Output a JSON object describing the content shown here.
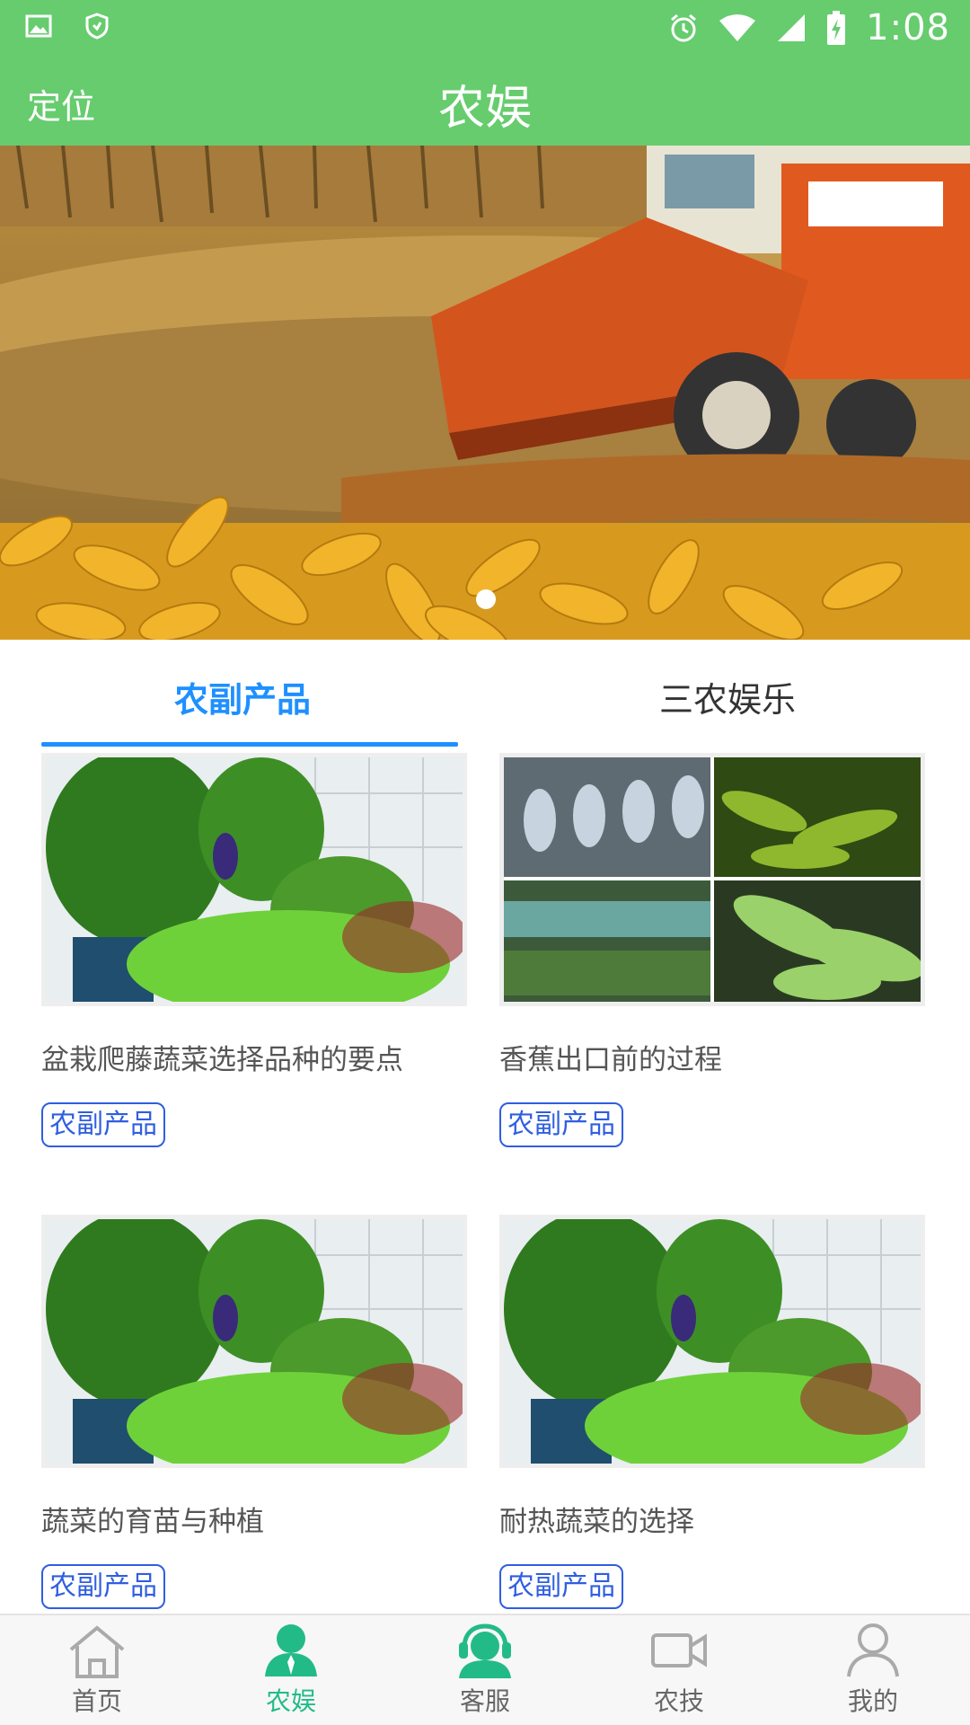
{
  "status_bar": {
    "time": "1:08"
  },
  "app_bar": {
    "left_label": "定位",
    "title": "农娱"
  },
  "banner": {
    "image": "corn-harvester-photo"
  },
  "tabs": [
    {
      "label": "农副产品",
      "active": true
    },
    {
      "label": "三农娱乐",
      "active": false
    }
  ],
  "cards": [
    {
      "title": "盆栽爬藤蔬菜选择品种的要点",
      "tag": "农副产品",
      "image": "vegetable-garden-photo"
    },
    {
      "title": "香蕉出口前的过程",
      "tag": "农副产品",
      "image": "banana-collage-photo"
    },
    {
      "title": "蔬菜的育苗与种植",
      "tag": "农副产品",
      "image": "vegetable-garden-photo"
    },
    {
      "title": "耐热蔬菜的选择",
      "tag": "农副产品",
      "image": "vegetable-garden-photo"
    }
  ],
  "bottom_nav": [
    {
      "label": "首页",
      "icon": "home-icon",
      "active": false
    },
    {
      "label": "农娱",
      "icon": "person-icon",
      "active": true
    },
    {
      "label": "客服",
      "icon": "headset-icon",
      "active": false
    },
    {
      "label": "农技",
      "icon": "video-icon",
      "active": false
    },
    {
      "label": "我的",
      "icon": "profile-icon",
      "active": false
    }
  ],
  "colors": {
    "primary_green": "#66cc6e",
    "tab_blue": "#1e90ff",
    "tag_blue": "#2f5ee0",
    "nav_active": "#22bb88"
  }
}
